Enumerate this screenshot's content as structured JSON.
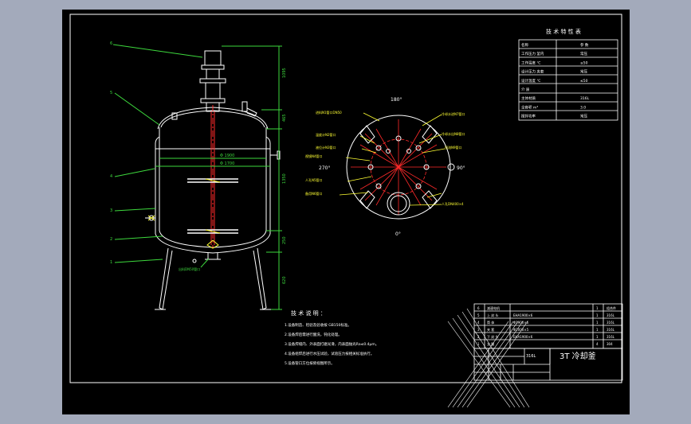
{
  "drawing": {
    "title": "3T 冷却釜",
    "material": "316L",
    "angle_labels": {
      "top": "180°",
      "right": "90°",
      "bottom": "0°",
      "left": "270°"
    },
    "dimensions": {
      "shell_diameter_outer": "Φ 1900",
      "shell_diameter_inner": "Φ 1700",
      "height_1": "1095",
      "height_2": "465",
      "height_3": "1350",
      "height_4": "250",
      "height_5": "620"
    },
    "callouts": [
      "6",
      "5",
      "4",
      "3",
      "2",
      "1"
    ],
    "outlet_label": "出料DN50管口",
    "nozzle_labels": [
      "进料N1管口DN50",
      "温度计N2管口",
      "液位计N3管口",
      "视镜N4管口",
      "人孔N5管口",
      "备用N6管口",
      "冷却水进N7管口",
      "冷却水出N8管口",
      "回流N9管口",
      "人孔DN400×4"
    ]
  },
  "tech_table": {
    "title": "技 术 特 性 表",
    "rows": [
      {
        "name": "名称",
        "value": "参 数"
      },
      {
        "name": "工作压力 釜内",
        "value": "常压"
      },
      {
        "name": "工作温度 ℃",
        "value": "≤50"
      },
      {
        "name": "设计压力 夹套",
        "value": "常压"
      },
      {
        "name": "设计温度 ℃",
        "value": "≤50"
      },
      {
        "name": "介 质",
        "value": ""
      },
      {
        "name": "主体材质",
        "value": "316L"
      },
      {
        "name": "全容积 m³",
        "value": "3.0"
      },
      {
        "name": "搅拌功率",
        "value": "常压"
      }
    ]
  },
  "notes": {
    "title": "技 术 说 明 ：",
    "lines": [
      "1.设备制造、检验及验收按 GB150标准。",
      "2.设备焊后需进行酸洗，钝化处理。",
      "3.设备焊缝内、外表面打磨光滑，内表面抛光Ra≤0.4μm。",
      "4.设备组焊后进行水压试验，试验压力按相关标准执行。",
      "5.设备管口方位按俯视图所示。"
    ]
  },
  "parts_list": {
    "rows": [
      {
        "no": "6",
        "name": "减速电机",
        "spec": "",
        "qty": "1",
        "mat": "组合件"
      },
      {
        "no": "5",
        "name": "上 封 头",
        "spec": "EHA1900×6",
        "qty": "1",
        "mat": "316L"
      },
      {
        "no": "4",
        "name": "筒 体",
        "spec": "Φ1900×6",
        "qty": "1",
        "mat": "316L"
      },
      {
        "no": "3",
        "name": "夹 套",
        "spec": "Φ2000×5",
        "qty": "1",
        "mat": "316L"
      },
      {
        "no": "2",
        "name": "下 封 头",
        "spec": "EHA1900×6",
        "qty": "1",
        "mat": "316L"
      },
      {
        "no": "1",
        "name": "支 腿",
        "spec": "",
        "qty": "4",
        "mat": "304"
      }
    ]
  }
}
